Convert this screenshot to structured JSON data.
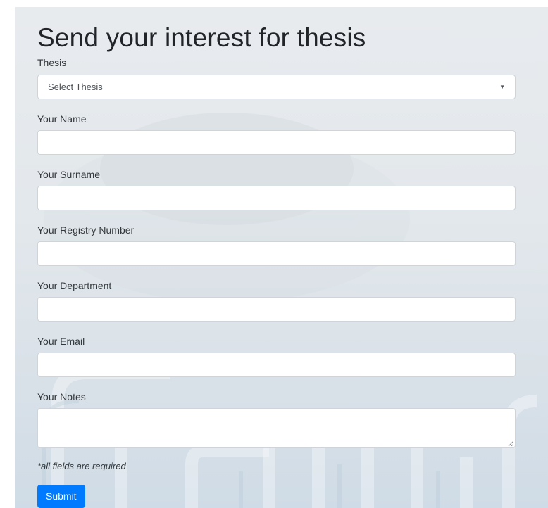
{
  "form": {
    "title": "Send your interest for thesis",
    "thesis_label": "Thesis",
    "thesis_selected": "Select Thesis",
    "name_label": "Your Name",
    "surname_label": "Your Surname",
    "registry_label": "Your Registry Number",
    "department_label": "Your Department",
    "email_label": "Your Email",
    "notes_label": "Your Notes",
    "required_note": "*all fields are required",
    "submit_label": "Submit"
  },
  "icons": {
    "select_caret": "caret-down-icon",
    "textarea_resize": "resize-handle-icon"
  },
  "colors": {
    "primary": "#007bff",
    "input_border": "#ced4da",
    "text": "#212529"
  }
}
